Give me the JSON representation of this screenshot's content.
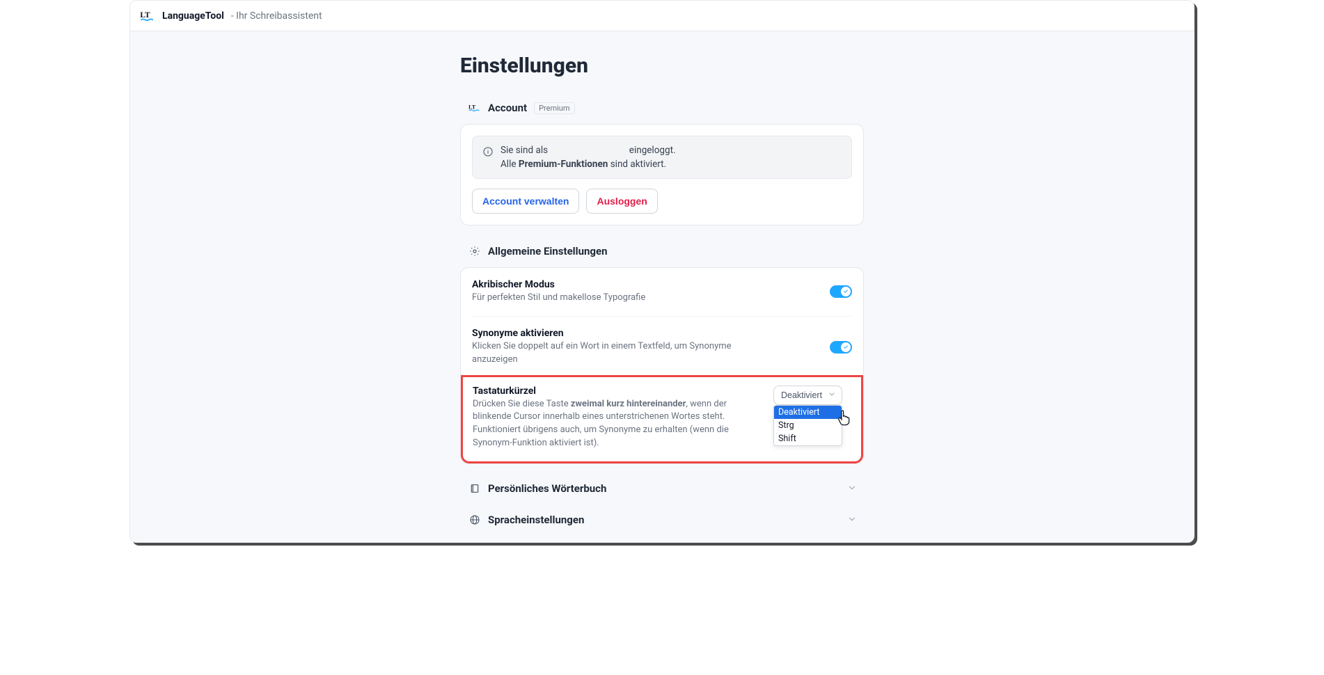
{
  "header": {
    "brand": "LanguageTool",
    "subtitle": " - Ihr Schreibassistent"
  },
  "page": {
    "title": "Einstellungen"
  },
  "account": {
    "section_title": "Account",
    "premium_badge": "Premium",
    "logged_in_prefix": "Sie sind als",
    "logged_in_suffix": "eingeloggt.",
    "all_prefix": "Alle ",
    "premium_bold": "Premium-Funktionen",
    "activated_suffix": " sind aktiviert.",
    "manage_label": "Account verwalten",
    "logout_label": "Ausloggen"
  },
  "general": {
    "section_title": "Allgemeine Einstellungen",
    "akribisch_title": "Akribischer Modus",
    "akribisch_desc": "Für perfekten Stil und makellose Typografie",
    "synonyme_title": "Synonyme aktivieren",
    "synonyme_desc": "Klicken Sie doppelt auf ein Wort in einem Textfeld, um Synonyme anzuzeigen",
    "kbd_title": "Tastaturkürzel",
    "kbd_desc_prefix": "Drücken Sie diese Taste ",
    "kbd_desc_bold": "zweimal kurz hintereinander",
    "kbd_desc_suffix": ", wenn der blinkende Cursor innerhalb eines unterstrichenen Wortes steht. Funktioniert übrigens auch, um Synonyme zu erhalten (wenn die Synonym-Funktion aktiviert ist).",
    "kbd_selected": "Deaktiviert",
    "kbd_options": {
      "o0": "Deaktiviert",
      "o1": "Strg",
      "o2": "Shift"
    }
  },
  "dictionary": {
    "section_title": "Persönliches Wörterbuch"
  },
  "language": {
    "section_title": "Spracheinstellungen"
  }
}
